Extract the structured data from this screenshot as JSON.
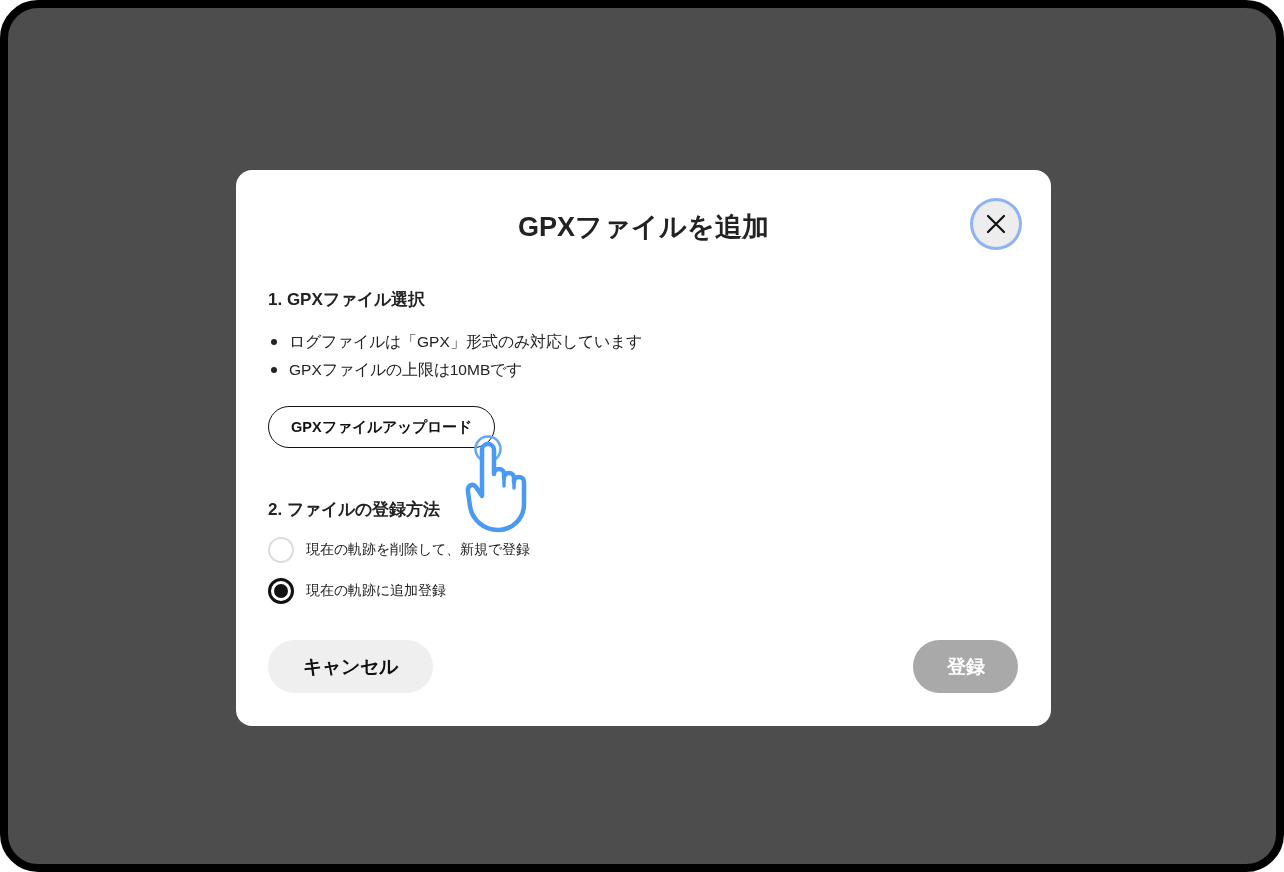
{
  "dialog": {
    "title": "GPXファイルを追加",
    "close_button": {
      "focused": true
    }
  },
  "section_1": {
    "heading": "1. GPXファイル選択",
    "notes": [
      "ログファイルは「GPX」形式のみ対応しています",
      "GPXファイルの上限は10MBです"
    ],
    "upload_button": "GPXファイルアップロード"
  },
  "section_2": {
    "heading": "2. ファイルの登録方法",
    "options": [
      {
        "label": "現在の軌跡を削除して、新規で登録",
        "selected": false
      },
      {
        "label": "現在の軌跡に追加登録",
        "selected": true
      }
    ]
  },
  "footer": {
    "cancel_button": "キャンセル",
    "submit_button": {
      "label": "登録",
      "disabled": true
    }
  }
}
